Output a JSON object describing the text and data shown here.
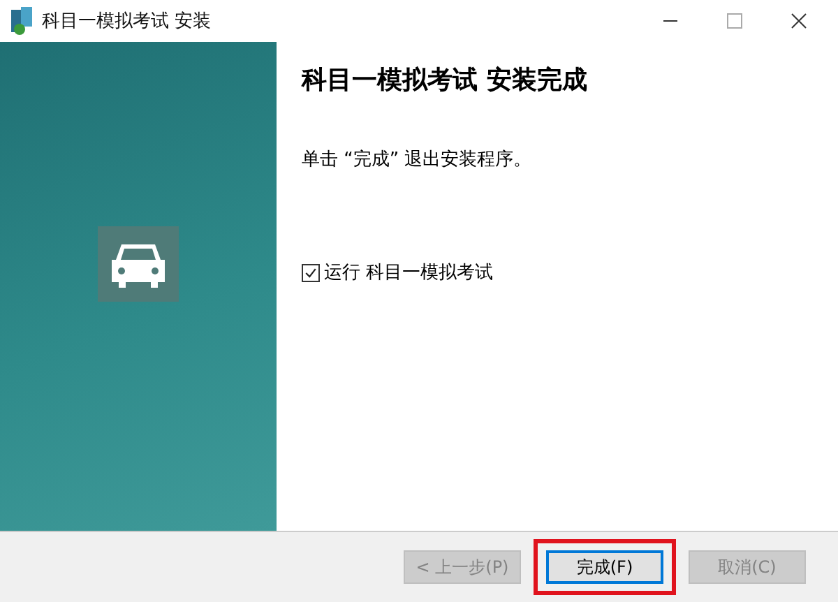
{
  "window": {
    "title": "科目一模拟考试  安装"
  },
  "heading": "科目一模拟考试 安装完成",
  "message": "单击 “完成” 退出安装程序。",
  "run_option": {
    "label": "运行 科目一模拟考试",
    "checked": true
  },
  "buttons": [
    {
      "label": "< 上一步(P)",
      "disabled": true,
      "default": false,
      "highlighted": false
    },
    {
      "label": "完成(F)",
      "disabled": false,
      "default": true,
      "highlighted": true
    },
    {
      "label": "取消(C)",
      "disabled": true,
      "default": false,
      "highlighted": false
    }
  ]
}
